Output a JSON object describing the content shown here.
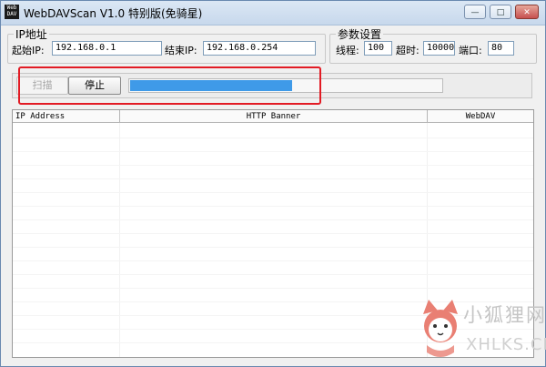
{
  "window": {
    "icon_text": "Web DAV",
    "title": "WebDAVScan V1.0 特别版(免骑星)",
    "controls": {
      "minimize": "—",
      "maximize": "□",
      "close": "✕"
    }
  },
  "ip_group": {
    "legend": "IP地址",
    "start_label": "起始IP:",
    "start_value": "192.168.0.1",
    "end_label": "结束IP:",
    "end_value": "192.168.0.254"
  },
  "params_group": {
    "legend": "参数设置",
    "threads_label": "线程:",
    "threads_value": "100",
    "timeout_label": "超时:",
    "timeout_value": "10000",
    "port_label": "端口:",
    "port_value": "80"
  },
  "toolbar": {
    "scan_label": "扫描",
    "stop_label": "停止",
    "progress_percent": 52
  },
  "table": {
    "columns": [
      "IP Address",
      "HTTP Banner",
      "WebDAV"
    ]
  },
  "watermark": {
    "cn": "小狐狸网",
    "en": "XHLKS.CN"
  },
  "colors": {
    "accent": "#3f9ae8",
    "highlight": "#e21b24"
  }
}
